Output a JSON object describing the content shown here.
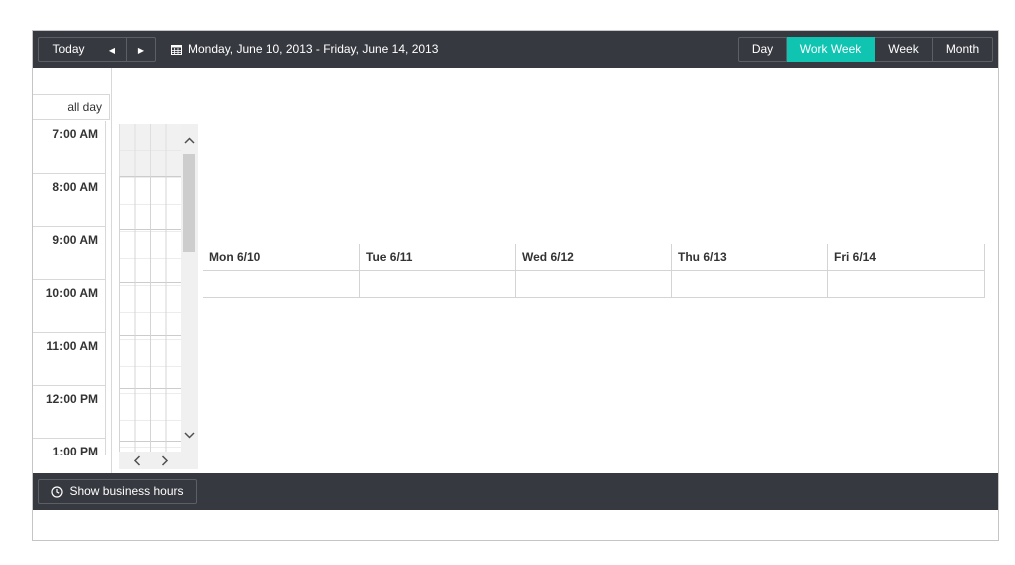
{
  "toolbar": {
    "today_label": "Today",
    "prev_icon": "prev-triangle-icon",
    "next_icon": "next-triangle-icon",
    "date_range": "Monday, June 10, 2013 - Friday, June 14, 2013",
    "calendar_icon": "calendar-icon",
    "views": [
      {
        "label": "Day",
        "active": false
      },
      {
        "label": "Work Week",
        "active": true
      },
      {
        "label": "Week",
        "active": false
      },
      {
        "label": "Month",
        "active": false
      }
    ],
    "accent_color": "#10c4b2",
    "bar_color": "#373940"
  },
  "allday_label": "all day",
  "times": [
    "7:00 AM",
    "8:00 AM",
    "9:00 AM",
    "10:00 AM",
    "11:00 AM",
    "12:00 PM",
    "1:00 PM"
  ],
  "days": [
    "Mon 6/10",
    "Tue 6/11",
    "Wed 6/12",
    "Thu 6/13",
    "Fri 6/14"
  ],
  "footer": {
    "business_hours_label": "Show business hours",
    "clock_icon": "clock-icon"
  }
}
